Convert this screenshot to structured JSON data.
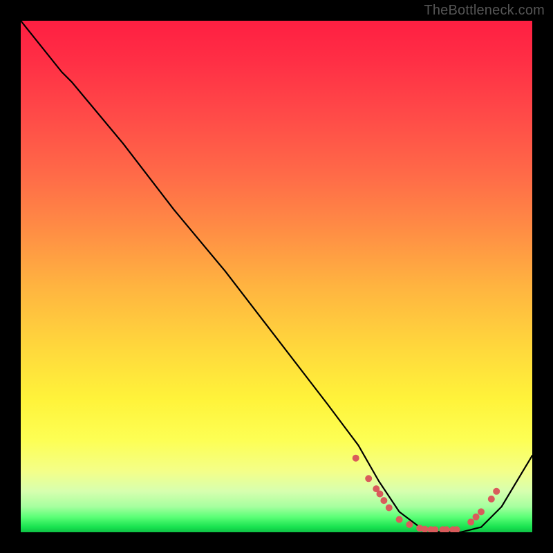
{
  "watermark": "TheBottleneck.com",
  "chart_data": {
    "type": "line",
    "title": "",
    "xlabel": "",
    "ylabel": "",
    "xlim": [
      0,
      100
    ],
    "ylim": [
      0,
      100
    ],
    "series": [
      {
        "name": "curve",
        "x": [
          0,
          8,
          10,
          20,
          30,
          40,
          50,
          60,
          66,
          70,
          74,
          78,
          82,
          86,
          90,
          94,
          100
        ],
        "y": [
          100,
          90,
          88,
          76,
          63,
          51,
          38,
          25,
          17,
          10,
          4,
          1,
          0,
          0,
          1,
          5,
          15
        ]
      }
    ],
    "markers": {
      "name": "dots",
      "color": "#d95b5b",
      "x": [
        65.5,
        68.0,
        69.5,
        70.2,
        71.0,
        72.0,
        74.0,
        76.0,
        78.0,
        79.0,
        80.2,
        81.0,
        82.5,
        83.2,
        84.5,
        85.2,
        88.0,
        89.0,
        90.0,
        92.0,
        93.0
      ],
      "y": [
        14.5,
        10.5,
        8.5,
        7.5,
        6.2,
        4.8,
        2.5,
        1.5,
        0.8,
        0.6,
        0.5,
        0.5,
        0.5,
        0.5,
        0.5,
        0.5,
        2.0,
        3.0,
        4.0,
        6.5,
        8.0
      ]
    },
    "gradient_stops": [
      {
        "pos": 0,
        "color": "#ff1f42"
      },
      {
        "pos": 8,
        "color": "#ff2f45"
      },
      {
        "pos": 18,
        "color": "#ff4948"
      },
      {
        "pos": 30,
        "color": "#ff6a48"
      },
      {
        "pos": 40,
        "color": "#ff8a45"
      },
      {
        "pos": 52,
        "color": "#ffb440"
      },
      {
        "pos": 64,
        "color": "#ffd83c"
      },
      {
        "pos": 74,
        "color": "#fff33a"
      },
      {
        "pos": 82,
        "color": "#fdff54"
      },
      {
        "pos": 88,
        "color": "#f4ff88"
      },
      {
        "pos": 92,
        "color": "#d7ffaf"
      },
      {
        "pos": 95,
        "color": "#a6ff9f"
      },
      {
        "pos": 97,
        "color": "#5cff77"
      },
      {
        "pos": 99,
        "color": "#18e24f"
      },
      {
        "pos": 100,
        "color": "#0fc246"
      }
    ]
  }
}
